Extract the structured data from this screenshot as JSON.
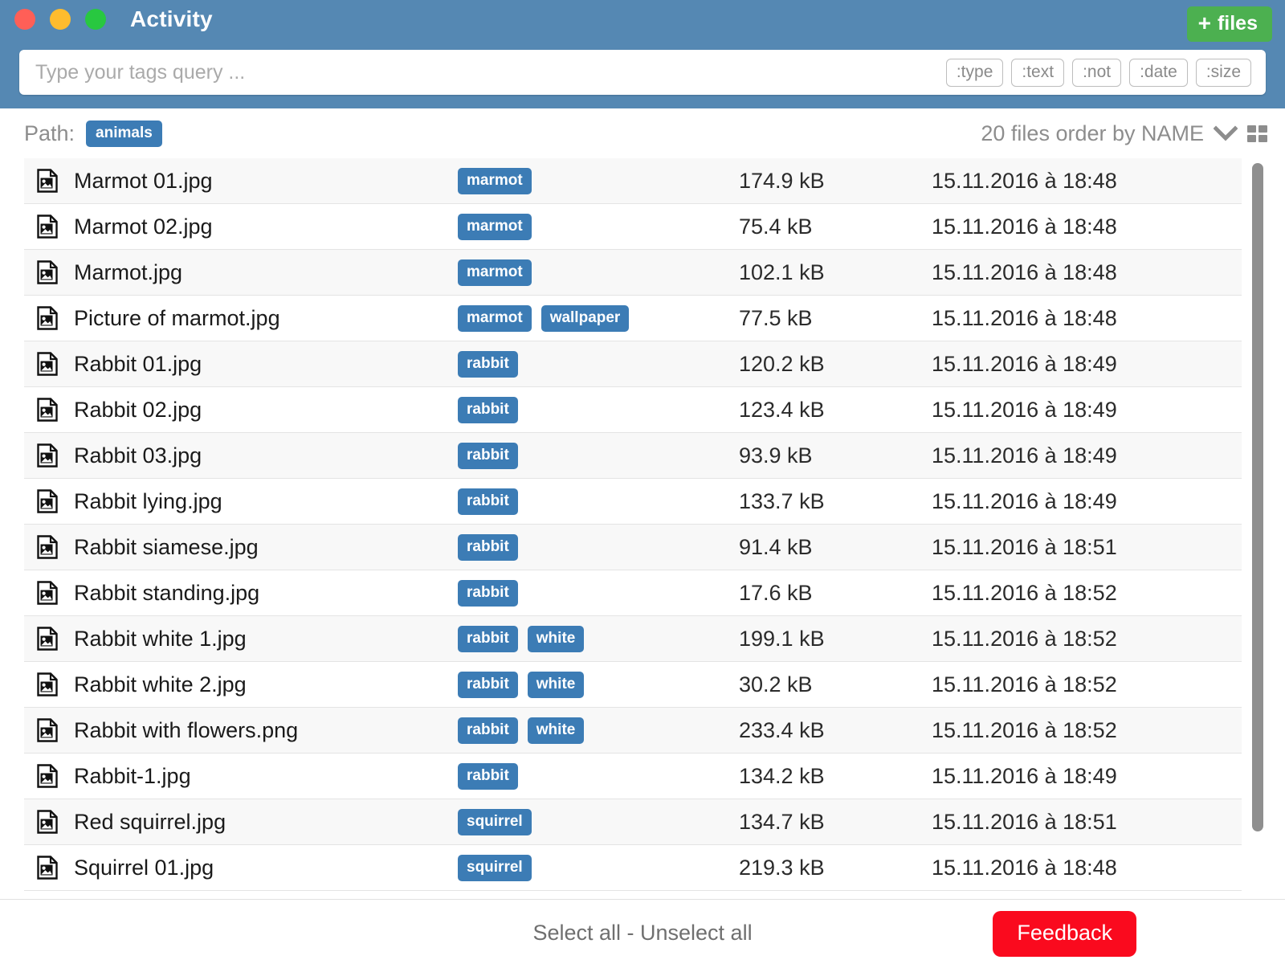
{
  "window": {
    "title": "Activity",
    "traffic_lights": [
      "close",
      "minimize",
      "maximize"
    ],
    "accent_blue": "#5588b3",
    "tag_blue": "#3c7cb5",
    "add_green": "#4cb050",
    "feedback_red": "#fa0a1e"
  },
  "header": {
    "add_files_label": "files",
    "add_files_icon": "plus-icon"
  },
  "search": {
    "value": "",
    "placeholder": "Type your tags query ...",
    "chips": [
      ":type",
      ":text",
      ":not",
      ":date",
      ":size"
    ]
  },
  "toolbar": {
    "path_label": "Path:",
    "path_tag": "animals",
    "order_text": "20 files order by NAME",
    "caret_icon": "chevron-down-icon",
    "view_icon": "grid-view-icon"
  },
  "files": [
    {
      "name": "Marmot 01.jpg",
      "tags": [
        "marmot"
      ],
      "size": "174.9 kB",
      "date": "15.11.2016 à 18:48"
    },
    {
      "name": "Marmot 02.jpg",
      "tags": [
        "marmot"
      ],
      "size": "75.4 kB",
      "date": "15.11.2016 à 18:48"
    },
    {
      "name": "Marmot.jpg",
      "tags": [
        "marmot"
      ],
      "size": "102.1 kB",
      "date": "15.11.2016 à 18:48"
    },
    {
      "name": "Picture of marmot.jpg",
      "tags": [
        "marmot",
        "wallpaper"
      ],
      "size": "77.5 kB",
      "date": "15.11.2016 à 18:48"
    },
    {
      "name": "Rabbit 01.jpg",
      "tags": [
        "rabbit"
      ],
      "size": "120.2 kB",
      "date": "15.11.2016 à 18:49"
    },
    {
      "name": "Rabbit 02.jpg",
      "tags": [
        "rabbit"
      ],
      "size": "123.4 kB",
      "date": "15.11.2016 à 18:49"
    },
    {
      "name": "Rabbit 03.jpg",
      "tags": [
        "rabbit"
      ],
      "size": "93.9 kB",
      "date": "15.11.2016 à 18:49"
    },
    {
      "name": "Rabbit lying.jpg",
      "tags": [
        "rabbit"
      ],
      "size": "133.7 kB",
      "date": "15.11.2016 à 18:49"
    },
    {
      "name": "Rabbit siamese.jpg",
      "tags": [
        "rabbit"
      ],
      "size": "91.4 kB",
      "date": "15.11.2016 à 18:51"
    },
    {
      "name": "Rabbit standing.jpg",
      "tags": [
        "rabbit"
      ],
      "size": "17.6 kB",
      "date": "15.11.2016 à 18:52"
    },
    {
      "name": "Rabbit white 1.jpg",
      "tags": [
        "rabbit",
        "white"
      ],
      "size": "199.1 kB",
      "date": "15.11.2016 à 18:52"
    },
    {
      "name": "Rabbit white 2.jpg",
      "tags": [
        "rabbit",
        "white"
      ],
      "size": "30.2 kB",
      "date": "15.11.2016 à 18:52"
    },
    {
      "name": "Rabbit with flowers.png",
      "tags": [
        "rabbit",
        "white"
      ],
      "size": "233.4 kB",
      "date": "15.11.2016 à 18:52"
    },
    {
      "name": "Rabbit-1.jpg",
      "tags": [
        "rabbit"
      ],
      "size": "134.2 kB",
      "date": "15.11.2016 à 18:49"
    },
    {
      "name": "Red squirrel.jpg",
      "tags": [
        "squirrel"
      ],
      "size": "134.7 kB",
      "date": "15.11.2016 à 18:51"
    },
    {
      "name": "Squirrel 01.jpg",
      "tags": [
        "squirrel"
      ],
      "size": "219.3 kB",
      "date": "15.11.2016 à 18:48"
    }
  ],
  "footer": {
    "select_all": "Select all",
    "separator": " - ",
    "unselect_all": "Unselect all",
    "feedback_label": "Feedback"
  }
}
